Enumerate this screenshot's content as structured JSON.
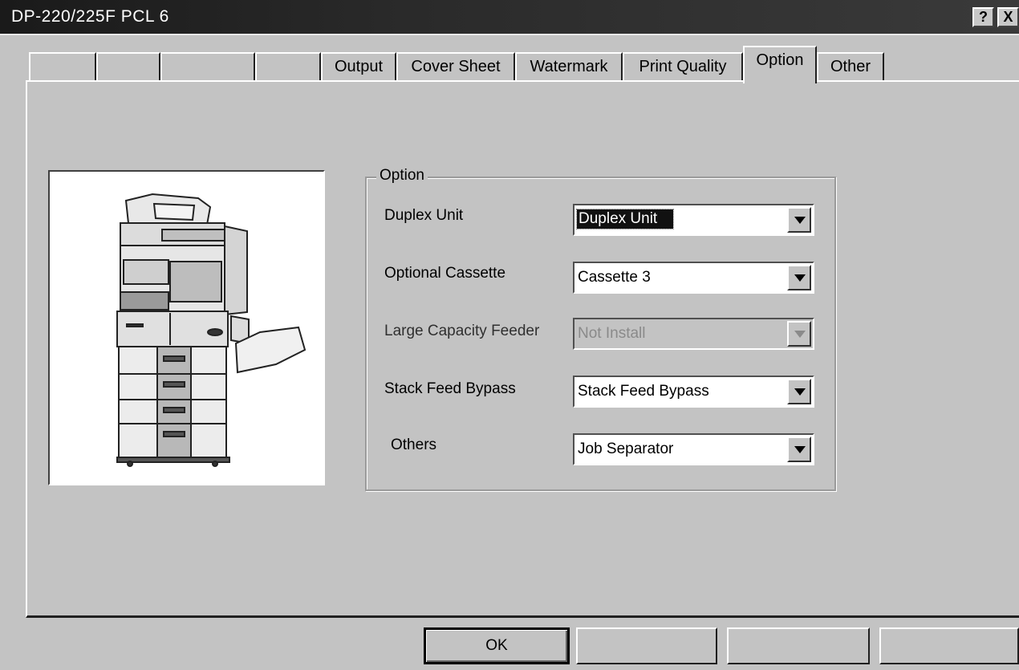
{
  "window": {
    "title": "DP-220/225F PCL 6",
    "help_label": "?",
    "close_label": "X"
  },
  "tabs": [
    {
      "label": ""
    },
    {
      "label": ""
    },
    {
      "label": ""
    },
    {
      "label": ""
    },
    {
      "label": "Output"
    },
    {
      "label": "Cover Sheet"
    },
    {
      "label": "Watermark"
    },
    {
      "label": "Print Quality"
    },
    {
      "label": "Option",
      "active": true
    },
    {
      "label": "Other"
    }
  ],
  "option_group": {
    "legend": "Option",
    "fields": [
      {
        "label": "Duplex Unit",
        "value": "Duplex Unit",
        "selected": true,
        "enabled": true
      },
      {
        "label": "Optional Cassette",
        "value": "Cassette 3",
        "enabled": true
      },
      {
        "label": "Large Capacity Feeder",
        "value": "Not Install",
        "enabled": false
      },
      {
        "label": "Stack Feed Bypass",
        "value": "Stack Feed Bypass",
        "enabled": true
      },
      {
        "label": "Others",
        "value": "Job Separator",
        "enabled": true
      }
    ]
  },
  "buttons": {
    "ok": "OK",
    "btn2": "",
    "btn3": "",
    "btn4": ""
  },
  "preview": {
    "icon": "copier-machine-illustration"
  }
}
